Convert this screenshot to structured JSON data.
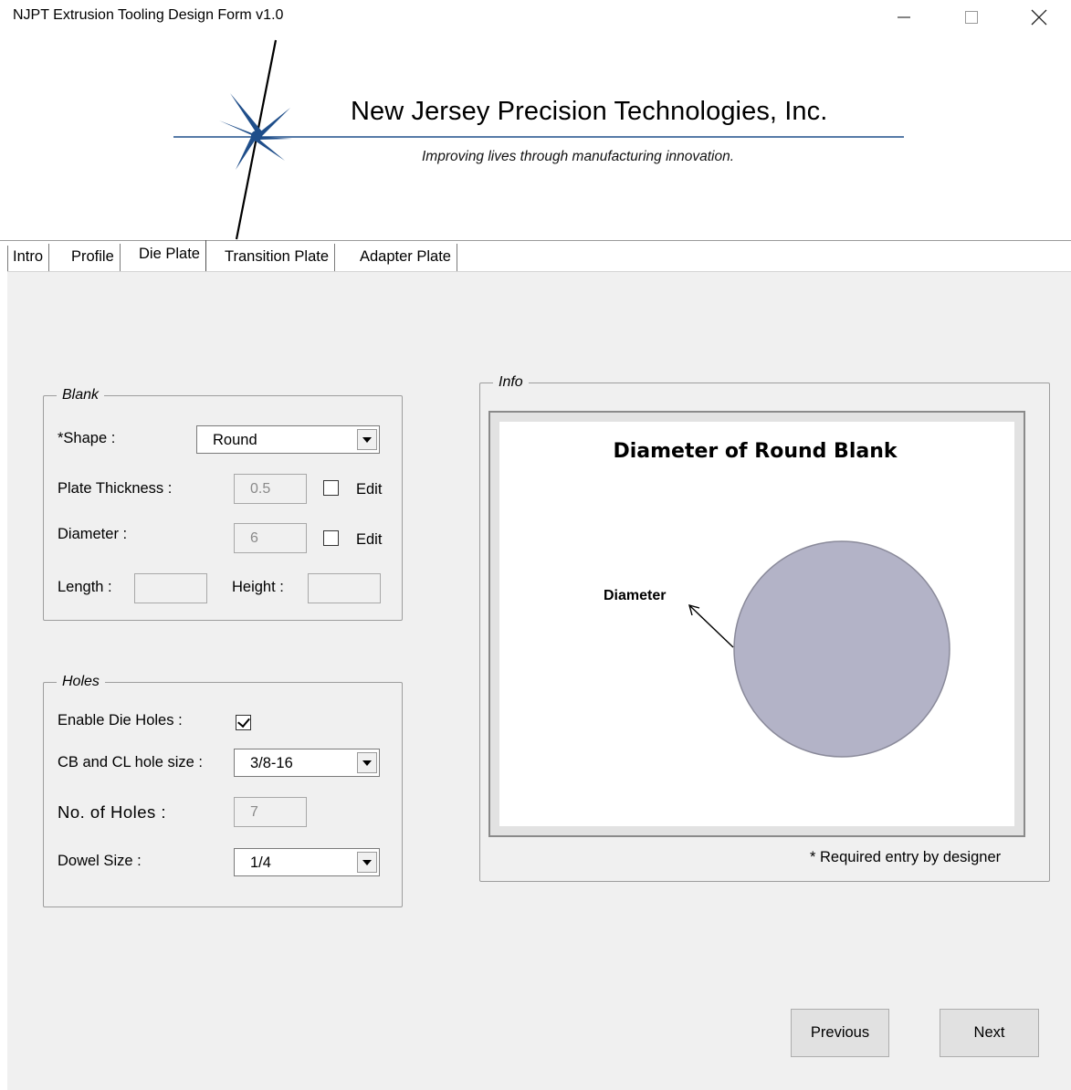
{
  "window": {
    "title": "NJPT Extrusion Tooling Design Form v1.0",
    "minimize_glyph": "—",
    "maximize_glyph": "☐",
    "close_glyph": "✕"
  },
  "header": {
    "company_name": "New Jersey Precision Technologies, Inc.",
    "tagline": "Improving lives through manufacturing innovation.",
    "logo_icon": "star-burst-logo",
    "brand_color": "#1f4e8a"
  },
  "tabs": [
    {
      "label": "Intro",
      "active": false
    },
    {
      "label": "Profile",
      "active": false
    },
    {
      "label": "Die Plate",
      "active": true
    },
    {
      "label": "Transition Plate",
      "active": false
    },
    {
      "label": "Adapter Plate",
      "active": false
    }
  ],
  "blank": {
    "group_label": "Blank",
    "shape_label": "*Shape :",
    "shape_value": "Round",
    "plate_thickness_label": "Plate Thickness :",
    "plate_thickness_value": "0.5",
    "plate_thickness_edit_label": "Edit",
    "plate_thickness_edit_checked": false,
    "diameter_label": "Diameter :",
    "diameter_value": "6",
    "diameter_edit_label": "Edit",
    "diameter_edit_checked": false,
    "length_label": "Length :",
    "length_value": "",
    "height_label": "Height :",
    "height_value": ""
  },
  "holes": {
    "group_label": "Holes",
    "enable_label": "Enable Die Holes :",
    "enable_checked": true,
    "hole_size_label": "CB and CL hole size :",
    "hole_size_value": "3/8-16",
    "no_holes_label": "No. of  Holes :",
    "no_holes_value": "7",
    "dowel_label": "Dowel Size :",
    "dowel_value": "1/4"
  },
  "info": {
    "group_label": "Info",
    "diagram_title": "Diameter of Round Blank",
    "diagram_callout": "Diameter",
    "circle_fill": "#b3b3c7",
    "required_note": "* Required entry by designer"
  },
  "buttons": {
    "previous": "Previous",
    "next": "Next"
  }
}
